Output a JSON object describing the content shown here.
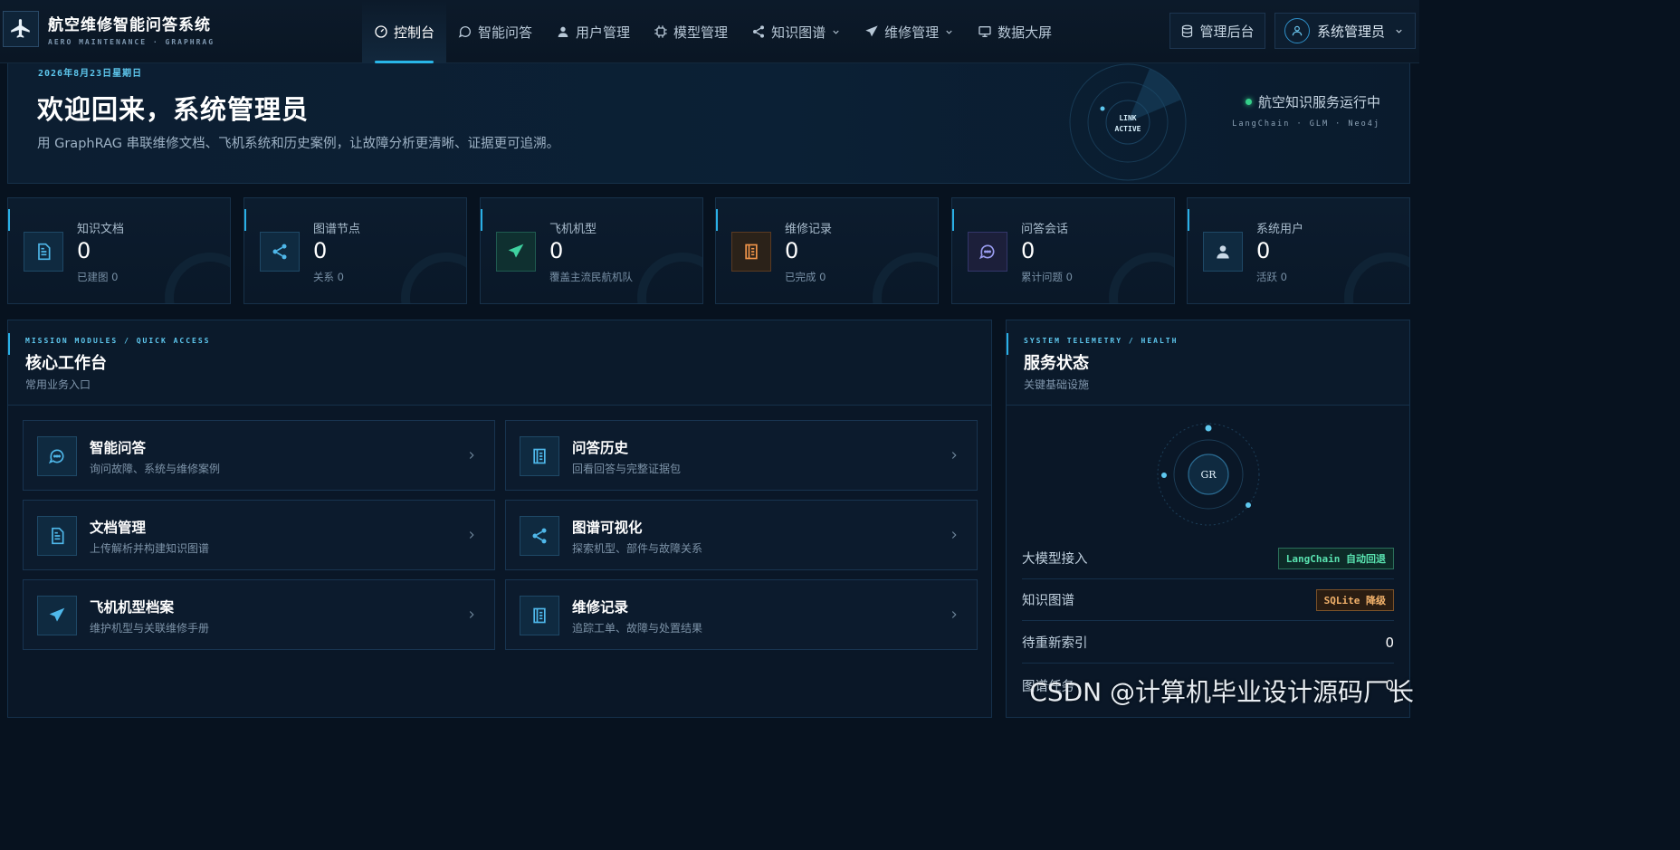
{
  "brand": {
    "title": "航空维修智能问答系统",
    "subtitle": "AERO MAINTENANCE · GRAPHRAG"
  },
  "nav": {
    "items": [
      {
        "label": "控制台",
        "icon": "dashboard-icon",
        "active": true
      },
      {
        "label": "智能问答",
        "icon": "chat-icon"
      },
      {
        "label": "用户管理",
        "icon": "user-icon"
      },
      {
        "label": "模型管理",
        "icon": "chip-icon"
      },
      {
        "label": "知识图谱",
        "icon": "share-icon",
        "dropdown": true
      },
      {
        "label": "维修管理",
        "icon": "plane-icon",
        "dropdown": true
      },
      {
        "label": "数据大屏",
        "icon": "screen-icon"
      }
    ],
    "admin": "管理后台",
    "user": "系统管理员"
  },
  "hero": {
    "date": "2026年8月23日星期日",
    "title": "欢迎回来，系统管理员",
    "desc": "用 GraphRAG 串联维修文档、飞机系统和历史案例，让故障分析更清晰、证据更可追溯。",
    "radar_line1": "LINK",
    "radar_line2": "ACTIVE",
    "status": "航空知识服务运行中",
    "stack": "LangChain · GLM · Neo4j"
  },
  "stats": [
    {
      "label": "知识文档",
      "value": "0",
      "sub": "已建图 0",
      "icon": "document-icon",
      "tone": "blue"
    },
    {
      "label": "图谱节点",
      "value": "0",
      "sub": "关系 0",
      "icon": "share-icon",
      "tone": "blue"
    },
    {
      "label": "飞机机型",
      "value": "0",
      "sub": "覆盖主流民航机队",
      "icon": "plane-icon",
      "tone": "green"
    },
    {
      "label": "维修记录",
      "value": "0",
      "sub": "已完成 0",
      "icon": "notebook-icon",
      "tone": "orange"
    },
    {
      "label": "问答会话",
      "value": "0",
      "sub": "累计问题 0",
      "icon": "chat-icon",
      "tone": "purple"
    },
    {
      "label": "系统用户",
      "value": "0",
      "sub": "活跃 0",
      "icon": "user-icon",
      "tone": "blue"
    }
  ],
  "workbench": {
    "tag": "MISSION MODULES / QUICK ACCESS",
    "title": "核心工作台",
    "sub": "常用业务入口",
    "tiles": [
      {
        "title": "智能问答",
        "desc": "询问故障、系统与维修案例",
        "icon": "chat-icon"
      },
      {
        "title": "问答历史",
        "desc": "回看回答与完整证据包",
        "icon": "notebook-icon"
      },
      {
        "title": "文档管理",
        "desc": "上传解析并构建知识图谱",
        "icon": "document-icon"
      },
      {
        "title": "图谱可视化",
        "desc": "探索机型、部件与故障关系",
        "icon": "share-icon"
      },
      {
        "title": "飞机机型档案",
        "desc": "维护机型与关联维修手册",
        "icon": "plane-icon"
      },
      {
        "title": "维修记录",
        "desc": "追踪工单、故障与处置结果",
        "icon": "notebook-icon"
      }
    ]
  },
  "services": {
    "tag": "SYSTEM TELEMETRY / HEALTH",
    "title": "服务状态",
    "sub": "关键基础设施",
    "orbit_label": "GR",
    "rows": [
      {
        "label": "大模型接入",
        "value": "LangChain 自动回退",
        "kind": "badge-green"
      },
      {
        "label": "知识图谱",
        "value": "SQLite 降级",
        "kind": "badge-orange"
      },
      {
        "label": "待重新索引",
        "value": "0",
        "kind": "text"
      },
      {
        "label": "图谱任务",
        "value": "0",
        "kind": "text"
      }
    ]
  },
  "watermark": "CSDN @计算机毕业设计源码厂长",
  "colors": {
    "accent": "#29b6e8",
    "bg": "#07121f",
    "ok": "#35d08a"
  }
}
